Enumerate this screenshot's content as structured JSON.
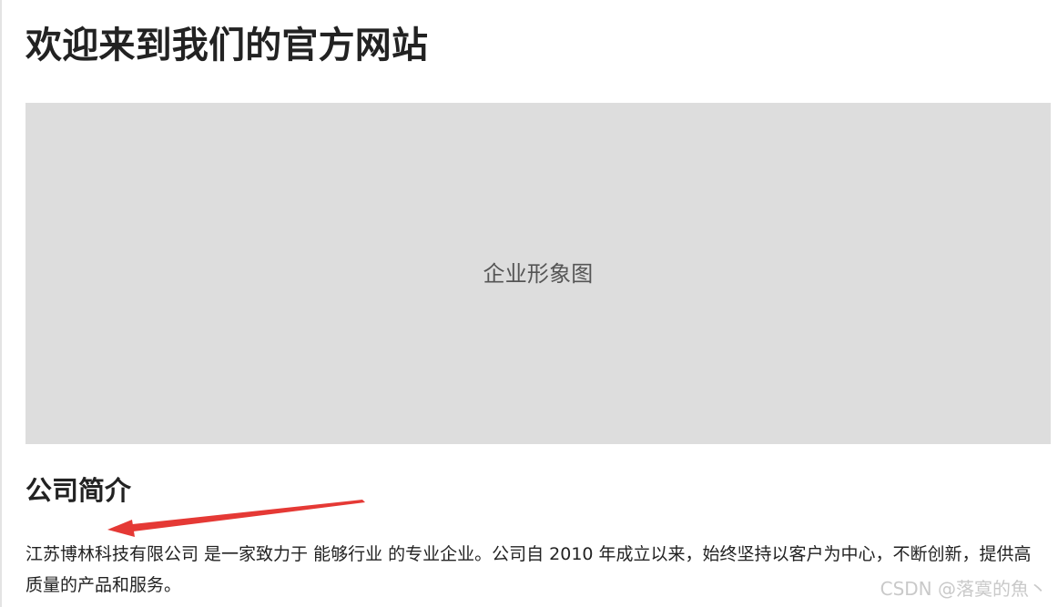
{
  "page": {
    "title": "欢迎来到我们的官方网站"
  },
  "hero": {
    "label": "企业形象图",
    "background": "#dddddd"
  },
  "about": {
    "heading": "公司简介",
    "paragraph": "江苏博林科技有限公司 是一家致力于 能够行业 的专业企业。公司自 2010 年成立以来，始终坚持以客户为中心，不断创新，提供高质量的产品和服务。"
  },
  "annotation": {
    "arrow_color": "#e53935"
  },
  "watermark": {
    "text": "CSDN @落寞的魚丶"
  },
  "colors": {
    "text": "#222222",
    "muted": "#555555",
    "watermark": "#c9c9c9"
  }
}
